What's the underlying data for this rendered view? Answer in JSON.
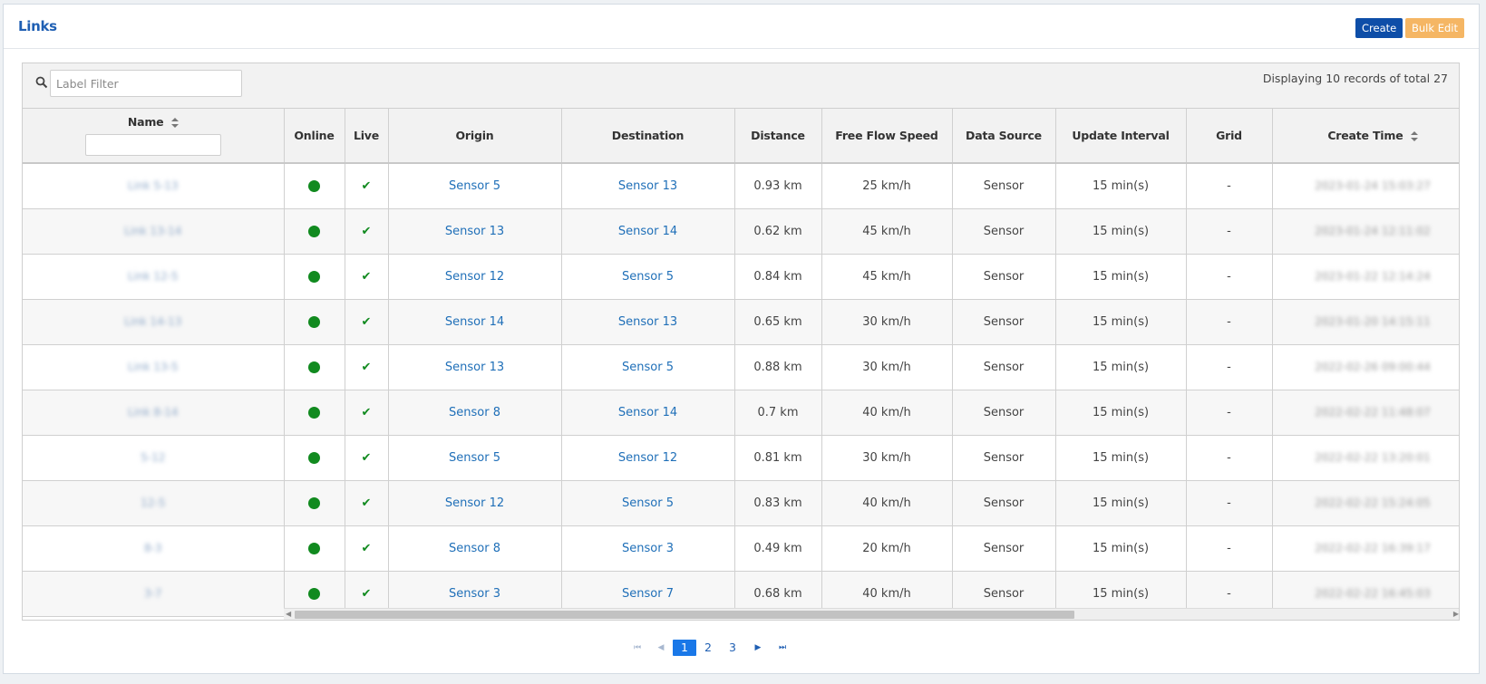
{
  "header": {
    "title": "Links",
    "create_label": "Create",
    "bulk_edit_label": "Bulk Edit"
  },
  "toolbar": {
    "filter_placeholder": "Label Filter",
    "records_text": "Displaying 10 records of total 27"
  },
  "columns": [
    "Name",
    "Online",
    "Live",
    "Origin",
    "Destination",
    "Distance",
    "Free Flow Speed",
    "Data Source",
    "Update Interval",
    "Grid",
    "Create Time"
  ],
  "rows": [
    {
      "name": "Link 5-13",
      "origin": "Sensor 5",
      "destination": "Sensor 13",
      "distance": "0.93 km",
      "speed": "25 km/h",
      "source": "Sensor",
      "interval": "15 min(s)",
      "grid": "-",
      "create_time": "2023-01-24 15:03:27"
    },
    {
      "name": "Link 13-14",
      "origin": "Sensor 13",
      "destination": "Sensor 14",
      "distance": "0.62 km",
      "speed": "45 km/h",
      "source": "Sensor",
      "interval": "15 min(s)",
      "grid": "-",
      "create_time": "2023-01-24 12:11:02"
    },
    {
      "name": "Link 12-5",
      "origin": "Sensor 12",
      "destination": "Sensor 5",
      "distance": "0.84 km",
      "speed": "45 km/h",
      "source": "Sensor",
      "interval": "15 min(s)",
      "grid": "-",
      "create_time": "2023-01-22 12:14:24"
    },
    {
      "name": "Link 14-13",
      "origin": "Sensor 14",
      "destination": "Sensor 13",
      "distance": "0.65 km",
      "speed": "30 km/h",
      "source": "Sensor",
      "interval": "15 min(s)",
      "grid": "-",
      "create_time": "2023-01-20 14:15:11"
    },
    {
      "name": "Link 13-5",
      "origin": "Sensor 13",
      "destination": "Sensor 5",
      "distance": "0.88 km",
      "speed": "30 km/h",
      "source": "Sensor",
      "interval": "15 min(s)",
      "grid": "-",
      "create_time": "2022-02-26 09:00:44"
    },
    {
      "name": "Link 8-14",
      "origin": "Sensor 8",
      "destination": "Sensor 14",
      "distance": "0.7 km",
      "speed": "40 km/h",
      "source": "Sensor",
      "interval": "15 min(s)",
      "grid": "-",
      "create_time": "2022-02-22 11:48:07"
    },
    {
      "name": "5-12",
      "origin": "Sensor 5",
      "destination": "Sensor 12",
      "distance": "0.81 km",
      "speed": "30 km/h",
      "source": "Sensor",
      "interval": "15 min(s)",
      "grid": "-",
      "create_time": "2022-02-22 13:20:01"
    },
    {
      "name": "12-5",
      "origin": "Sensor 12",
      "destination": "Sensor 5",
      "distance": "0.83 km",
      "speed": "40 km/h",
      "source": "Sensor",
      "interval": "15 min(s)",
      "grid": "-",
      "create_time": "2022-02-22 15:24:05"
    },
    {
      "name": "8-3",
      "origin": "Sensor 8",
      "destination": "Sensor 3",
      "distance": "0.49 km",
      "speed": "20 km/h",
      "source": "Sensor",
      "interval": "15 min(s)",
      "grid": "-",
      "create_time": "2022-02-22 16:39:17"
    },
    {
      "name": "3-7",
      "origin": "Sensor 3",
      "destination": "Sensor 7",
      "distance": "0.68 km",
      "speed": "40 km/h",
      "source": "Sensor",
      "interval": "15 min(s)",
      "grid": "-",
      "create_time": "2022-02-22 16:45:03"
    }
  ],
  "pagination": {
    "pages": [
      "1",
      "2",
      "3"
    ],
    "current": "1"
  },
  "colors": {
    "online": "#118a1f",
    "live": "#118a1f",
    "link": "#1f6fb8",
    "create_button": "#0e4ea8",
    "bulk_edit_button": "#f5b664"
  },
  "icons": {
    "online": "status-dot-icon",
    "live": "check-icon",
    "search": "search-icon",
    "sort": "sort-icon"
  }
}
